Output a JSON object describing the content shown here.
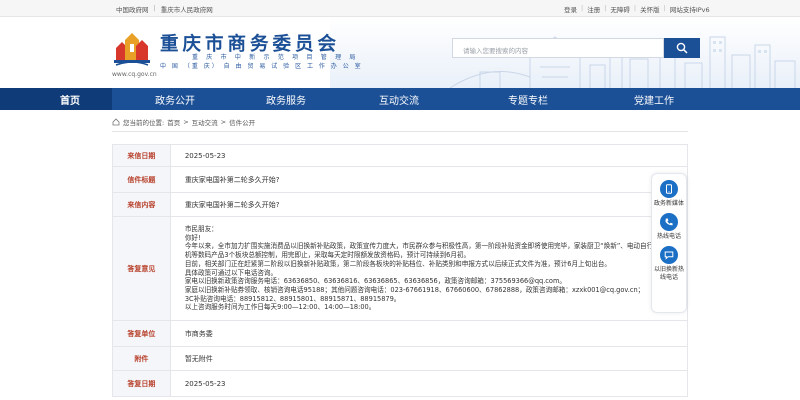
{
  "topbar": {
    "left_links": [
      "中国政府网",
      "重庆市人民政府网"
    ],
    "right_links": [
      "登录",
      "注册",
      "无障碍",
      "关怀版",
      "网站支持IPv6"
    ]
  },
  "header": {
    "site_title": "重庆市商务委员会",
    "subtitle_line1": "重 庆 市 中 新 示 范 项 目 管 理 局",
    "subtitle_line2": "中 国 （重 庆） 自 由 贸 易 试 验 区 工 作 办 公 室",
    "domain": "www.cq.gov.cn",
    "search_placeholder": "请输入您要搜索的内容"
  },
  "nav": {
    "items": [
      {
        "label": "首页",
        "active": true
      },
      {
        "label": "政务公开",
        "active": false
      },
      {
        "label": "政务服务",
        "active": false
      },
      {
        "label": "互动交流",
        "active": false
      },
      {
        "label": "专题专栏",
        "active": false
      },
      {
        "label": "党建工作",
        "active": false
      }
    ]
  },
  "breadcrumb": {
    "prefix": "您当前的位置:",
    "items": [
      "首页",
      "互动交流",
      "信件公开"
    ],
    "separator": ">"
  },
  "letter": {
    "labels": {
      "date": "来信日期",
      "title": "信件标题",
      "content": "来信内容",
      "reply": "答复意见",
      "unit": "答复单位",
      "attachment": "附件",
      "reply_date": "答复日期"
    },
    "date": "2025-05-23",
    "title": "重庆家电国补第二轮多久开始?",
    "content": "重庆家电国补第二轮多久开始?",
    "reply_lines": [
      "市民朋友：",
      "你好!",
      "    今年以来，全市加力扩围实施消费品以旧换新补贴政策，政策宣传力度大，市民群众参与积极性高，第一阶段补贴资金即将使用完毕，家装厨卫“焕新”、电动自行车、手",
      "机等数码产品3个板块总额控制，用完即止，采取每天定时限额发放资格码，预计可持续到6月初。",
      "    目前，相关部门正在赶紧第二阶段以旧换新补贴政策，第二阶段各板块的补贴档位、补贴类别和申报方式以后续正式文件为准，预计6月上旬出台。",
      "    具体政策可通过以下电话咨询。",
      "    家电以旧换新政策咨询服务电话：63636850、63636816、63636865、63636856，政策咨询邮箱：375569366@qq.com。",
      "    家庭以旧换新补贴券领取、核销咨询电话95188；其他问题咨询电话：023-67661918、67660600、67862888，政策咨询邮箱：xzxk001@cq.gov.cn；",
      "    3C补贴咨询电话：88915812、88915801、88915871、88915879。",
      "    以上咨询服务时间为工作日每天9:00—12:00、14:00—18:00。"
    ],
    "unit": "市商务委",
    "attachment": "暂无附件",
    "reply_date": "2025-05-23"
  },
  "side_panel": {
    "items": [
      {
        "label": "政务新媒体",
        "icon": "phone-icon"
      },
      {
        "label": "热线电话",
        "icon": "phone-call-icon"
      },
      {
        "label": "以旧换新热\n线电话",
        "icon": "chat-icon"
      }
    ]
  },
  "colors": {
    "primary_blue": "#1b4f96",
    "label_red": "#b8402c",
    "side_icon_blue": "#1b6fc5"
  }
}
